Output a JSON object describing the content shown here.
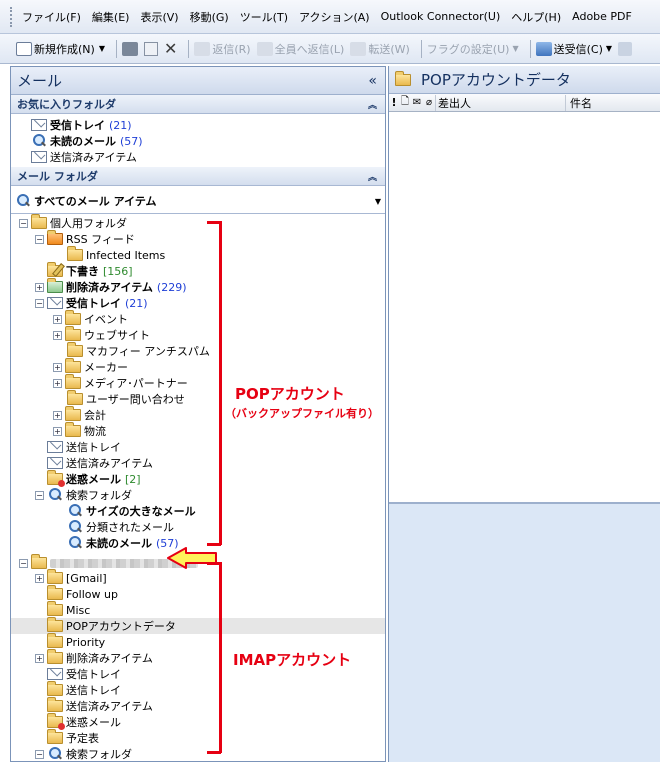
{
  "menubar": {
    "items": [
      "ファイル(F)",
      "編集(E)",
      "表示(V)",
      "移動(G)",
      "ツール(T)",
      "アクション(A)",
      "Outlook Connector(U)",
      "ヘルプ(H)",
      "Adobe PDF"
    ]
  },
  "toolbar": {
    "new_label": "新規作成(N)",
    "reply_label": "返信(R)",
    "reply_all_label": "全員へ返信(L)",
    "forward_label": "転送(W)",
    "flag_label": "フラグの設定(U)",
    "send_receive_label": "送受信(C)"
  },
  "nav": {
    "title": "メール",
    "collapse_glyph": "«",
    "favorites": {
      "header": "お気に入りフォルダ",
      "items": [
        {
          "label": "受信トレイ",
          "count": "(21)"
        },
        {
          "label": "未読のメール",
          "count": "(57)"
        },
        {
          "label": "送信済みアイテム",
          "count": ""
        }
      ]
    },
    "mail_folders": {
      "header": "メール フォルダ",
      "all_items_label": "すべてのメール アイテム"
    },
    "tree": {
      "personal": "個人用フォルダ",
      "rss": "RSS フィード",
      "infected": "Infected Items",
      "drafts": "下書き",
      "drafts_count": "[156]",
      "deleted": "削除済みアイテム",
      "deleted_count": "(229)",
      "inbox": "受信トレイ",
      "inbox_count": "(21)",
      "event": "イベント",
      "website": "ウェブサイト",
      "mcafee": "マカフィー アンチスパム",
      "maker": "メーカー",
      "media": "メディア･パートナー",
      "user_inquiry": "ユーザー問い合わせ",
      "meeting": "会計",
      "logistics": "物流",
      "outbox": "送信トレイ",
      "sent": "送信済みアイテム",
      "junk": "迷惑メール",
      "junk_count": "[2]",
      "search": "検索フォルダ",
      "large_mail": "サイズの大きなメール",
      "categorized": "分類されたメール",
      "unread": "未読のメール",
      "unread_count": "(57)",
      "gmail": "[Gmail]",
      "follow_up": "Follow up",
      "misc": "Misc",
      "pop_data": "POPアカウントデータ",
      "priority": "Priority",
      "imap_deleted": "削除済みアイテム",
      "imap_inbox": "受信トレイ",
      "imap_outbox": "送信トレイ",
      "imap_sent": "送信済みアイテム",
      "imap_junk": "迷惑メール",
      "imap_calendar": "予定表",
      "imap_search": "検索フォルダ"
    }
  },
  "annotations": {
    "pop_title": "POPアカウント",
    "pop_sub": "（バックアップファイル有り）",
    "imap_title": "IMAPアカウント"
  },
  "content": {
    "folder_title": "POPアカウントデータ",
    "col_flag": "!",
    "col_from": "差出人",
    "col_subject": "件名"
  },
  "colors": {
    "annotation": "#e60012",
    "selected_row": "#e6e6e6",
    "arrow_fill": "#fff35a"
  }
}
